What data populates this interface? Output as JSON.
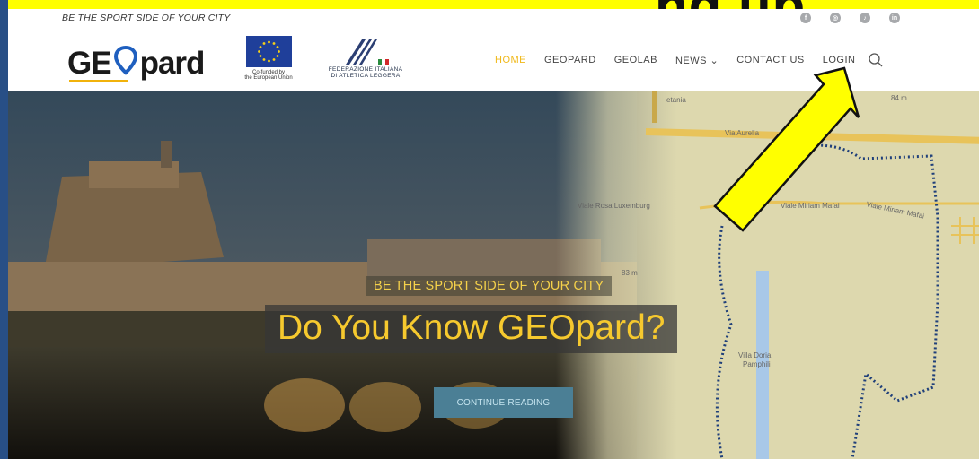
{
  "banner": {
    "title": "ng up"
  },
  "site": {
    "tagline": "BE THE SPORT SIDE OF YOUR CITY",
    "logo": {
      "left": "GE",
      "right": "pard"
    },
    "eu_caption_line1": "Co-funded by",
    "eu_caption_line2": "the European Union",
    "fidal_caption_line1": "FEDERAZIONE ITALIANA",
    "fidal_caption_line2": "DI ATLETICA LEGGERA",
    "socials": [
      {
        "icon": "facebook-icon"
      },
      {
        "icon": "instagram-icon"
      },
      {
        "icon": "tiktok-icon"
      },
      {
        "icon": "linkedin-icon"
      }
    ]
  },
  "nav": {
    "items": [
      "HOME",
      "GEOPARD",
      "GEOLAB",
      "NEWS ⌄",
      "CONTACT US",
      "LOGIN"
    ],
    "active_index": 0,
    "accent": "#f0b91b"
  },
  "hero": {
    "subtitle": "BE THE SPORT SIDE OF YOUR CITY",
    "title": "Do You Know GEOpard?",
    "button": "CONTINUE READING"
  },
  "map_labels": {
    "elevation": "84 m",
    "aurelia": "Via Aurelia",
    "rosa": "Viale Rosa Luxemburg",
    "mafai": "Viale Miriam Mafai",
    "mafai2": "Viale Miriam Mafai",
    "elevation2": "83 m",
    "villa1": "Villa Doria",
    "villa2": "Pamphili",
    "street": "etania"
  },
  "colors": {
    "banner": "#ffff00",
    "arrow": "#ffff00",
    "frame": "#284f86"
  }
}
